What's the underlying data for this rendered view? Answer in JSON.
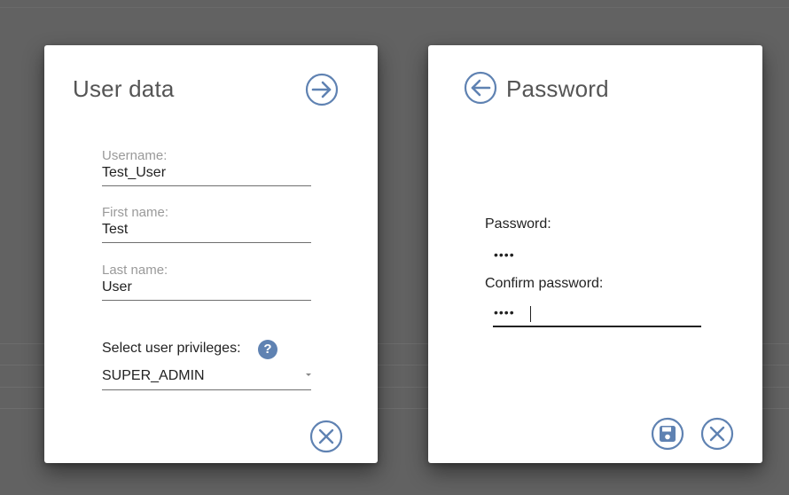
{
  "user_card": {
    "title": "User data",
    "fields": [
      {
        "label": "Username:",
        "value": "Test_User"
      },
      {
        "label": "First name:",
        "value": "Test"
      },
      {
        "label": "Last name:",
        "value": "User"
      }
    ],
    "privileges_label": "Select user privileges:",
    "privileges_help": "?",
    "privileges_value": "SUPER_ADMIN",
    "next_icon": "arrow-right-circle-icon",
    "close_icon": "close-circle-icon"
  },
  "password_card": {
    "title": "Password",
    "password_label": "Password:",
    "password_value": "••••",
    "confirm_label": "Confirm password:",
    "confirm_value": "••••",
    "back_icon": "arrow-left-circle-icon",
    "save_icon": "save-icon",
    "close_icon": "close-circle-icon"
  },
  "colors": {
    "accent": "#5f82b2",
    "backdrop": "#626262",
    "card": "#ffffff"
  }
}
